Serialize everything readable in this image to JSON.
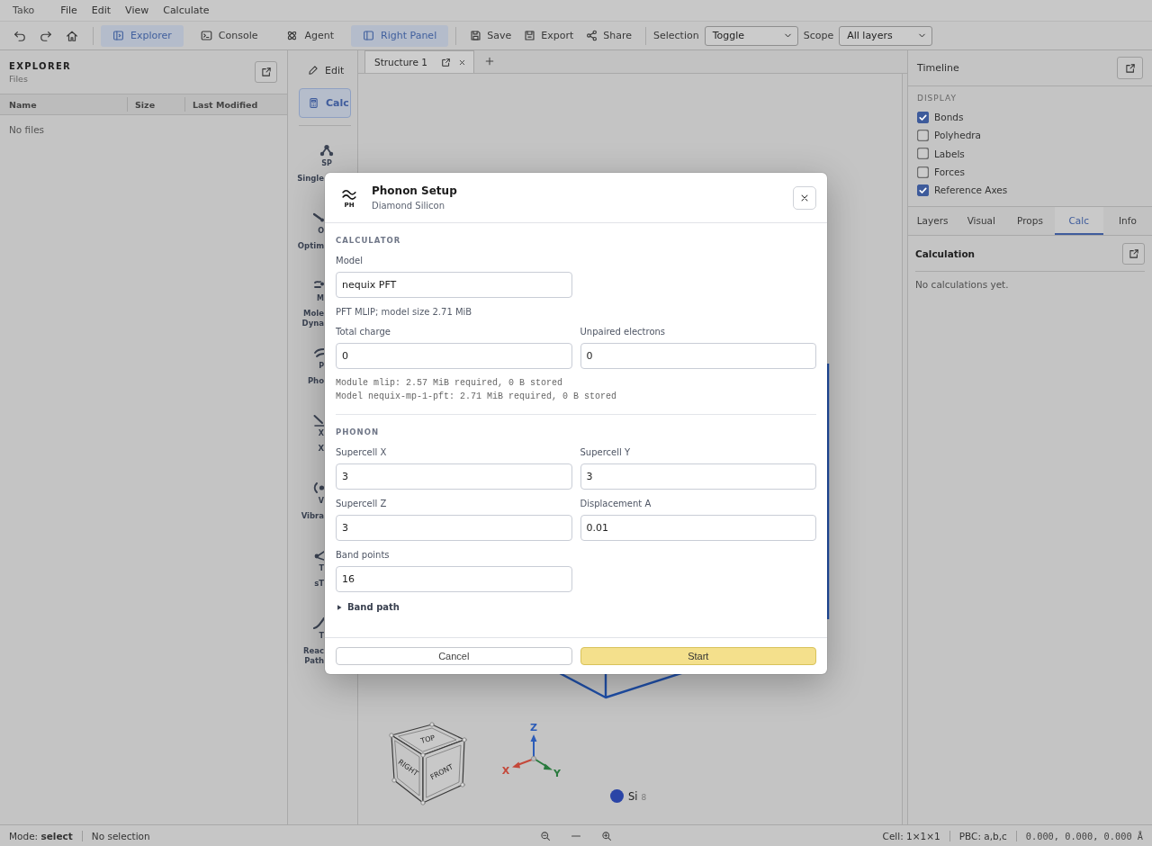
{
  "menu_bar": {
    "app_name": "Tako",
    "menus": [
      "File",
      "Edit",
      "View",
      "Calculate"
    ]
  },
  "toolbar": {
    "toggles": [
      {
        "label": "Explorer",
        "on": true
      },
      {
        "label": "Console",
        "on": false
      },
      {
        "label": "Agent",
        "on": false
      },
      {
        "label": "Right Panel",
        "on": true
      }
    ],
    "actions": [
      {
        "label": "Save"
      },
      {
        "label": "Export"
      },
      {
        "label": "Share"
      }
    ],
    "selection": {
      "label": "Selection",
      "value": "Toggle"
    },
    "scope": {
      "label": "Scope",
      "value": "All layers"
    }
  },
  "explorer": {
    "title": "EXPLORER",
    "subtitle": "Files",
    "columns": [
      "Name",
      "Size",
      "Last Modified"
    ],
    "empty_text": "No files"
  },
  "tool_column": {
    "modes": [
      {
        "label": "Edit",
        "selected": false
      },
      {
        "label": "Calc",
        "selected": true
      }
    ],
    "tools": [
      {
        "kind": "full",
        "abbr": "SP",
        "label_lines": [
          "Single"
        ]
      },
      {
        "kind": "cut",
        "abbr": "O",
        "label_lines": [
          "Optim"
        ]
      },
      {
        "kind": "cut",
        "abbr": "M",
        "label_lines": [
          "Mole",
          "Dyna"
        ]
      },
      {
        "kind": "cut",
        "abbr": "P",
        "label_lines": [
          "Pho"
        ]
      },
      {
        "kind": "cut",
        "abbr": "X",
        "label_lines": [
          "X"
        ]
      },
      {
        "kind": "cut",
        "abbr": "V",
        "label_lines": [
          "Vibra"
        ]
      },
      {
        "kind": "cut",
        "abbr": "T",
        "label_lines": [
          "sT"
        ]
      },
      {
        "kind": "cut",
        "abbr": "T",
        "label_lines": [
          "Reac",
          "Path"
        ]
      }
    ]
  },
  "viewport": {
    "tabs": [
      {
        "label": "Structure 1",
        "selected": true
      }
    ],
    "view_cube": {
      "faces": [
        "TOP",
        "RIGHT",
        "FRONT"
      ]
    },
    "axes": [
      {
        "label": "Z",
        "color": "#2c5cb8"
      },
      {
        "label": "X",
        "color": "#c4483a"
      },
      {
        "label": "Y",
        "color": "#2a7a3e"
      }
    ],
    "legend": [
      {
        "element": "Si",
        "count": "8",
        "color": "#2a44a6"
      }
    ]
  },
  "right_panel": {
    "timeline": "Timeline",
    "display": {
      "heading": "DISPLAY",
      "items": [
        {
          "label": "Bonds",
          "checked": true
        },
        {
          "label": "Polyhedra",
          "checked": false
        },
        {
          "label": "Labels",
          "checked": false
        },
        {
          "label": "Forces",
          "checked": false
        },
        {
          "label": "Reference Axes",
          "checked": true
        }
      ]
    },
    "tabs": [
      {
        "label": "Layers",
        "selected": false
      },
      {
        "label": "Visual",
        "selected": false
      },
      {
        "label": "Props",
        "selected": false
      },
      {
        "label": "Calc",
        "selected": true
      },
      {
        "label": "Info",
        "selected": false
      }
    ],
    "calculation": {
      "title": "Calculation",
      "empty_text": "No calculations yet."
    }
  },
  "dialog": {
    "icon_caption": "PH",
    "title": "Phonon Setup",
    "subtitle": "Diamond Silicon",
    "sections": [
      {
        "heading": "CALCULATOR",
        "rows": [
          {
            "kind": "fields",
            "fields": [
              {
                "label": "Model",
                "value": "nequix PFT"
              }
            ]
          },
          {
            "kind": "note",
            "text": "PFT MLIP; model size 2.71 MiB"
          },
          {
            "kind": "fields",
            "fields": [
              {
                "label": "Total charge",
                "value": "0"
              },
              {
                "label": "Unpaired electrons",
                "value": "0"
              }
            ]
          },
          {
            "kind": "mono",
            "lines": [
              "Module mlip: 2.57 MiB required, 0 B stored",
              "Model nequix-mp-1-pft: 2.71 MiB required, 0 B stored"
            ]
          }
        ]
      },
      {
        "heading": "PHONON",
        "rows": [
          {
            "kind": "fields",
            "fields": [
              {
                "label": "Supercell X",
                "value": "3"
              },
              {
                "label": "Supercell Y",
                "value": "3"
              }
            ]
          },
          {
            "kind": "fields",
            "fields": [
              {
                "label": "Supercell Z",
                "value": "3"
              },
              {
                "label": "Displacement A",
                "value": "0.01"
              }
            ]
          },
          {
            "kind": "fields",
            "fields": [
              {
                "label": "Band points",
                "value": "16"
              }
            ]
          },
          {
            "kind": "disclosure",
            "label": "Band path",
            "expanded": false
          }
        ]
      }
    ],
    "buttons": [
      {
        "label": "Cancel",
        "kind": "secondary"
      },
      {
        "label": "Start",
        "kind": "primary"
      }
    ]
  },
  "status_bar": {
    "mode": "Mode: **select**",
    "selection": "No selection",
    "cell": "Cell: 1×1×1",
    "pbc": "PBC: a,b,c",
    "cursor": "0.000, 0.000, 0.000 Å"
  }
}
